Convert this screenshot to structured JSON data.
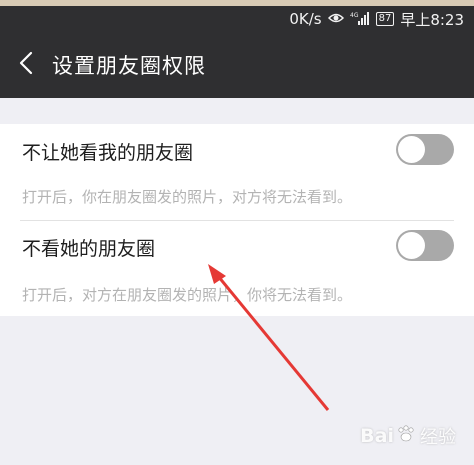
{
  "status_bar": {
    "speed": "0K/s",
    "eye_icon": "eye-icon",
    "signal": "4G",
    "battery": "87",
    "time": "早上8:23"
  },
  "header": {
    "title": "设置朋友圈权限",
    "back_icon": "chevron-left-icon"
  },
  "settings": [
    {
      "label": "不让她看我的朋友圈",
      "description": "打开后，你在朋友圈发的照片，对方将无法看到。",
      "enabled": false
    },
    {
      "label": "不看她的朋友圈",
      "description": "打开后，对方在朋友圈发的照片，你将无法看到。",
      "enabled": false
    }
  ],
  "annotation": {
    "arrow_color": "#e53935"
  },
  "watermark": {
    "brand": "Bai",
    "brand_2": "经验"
  }
}
